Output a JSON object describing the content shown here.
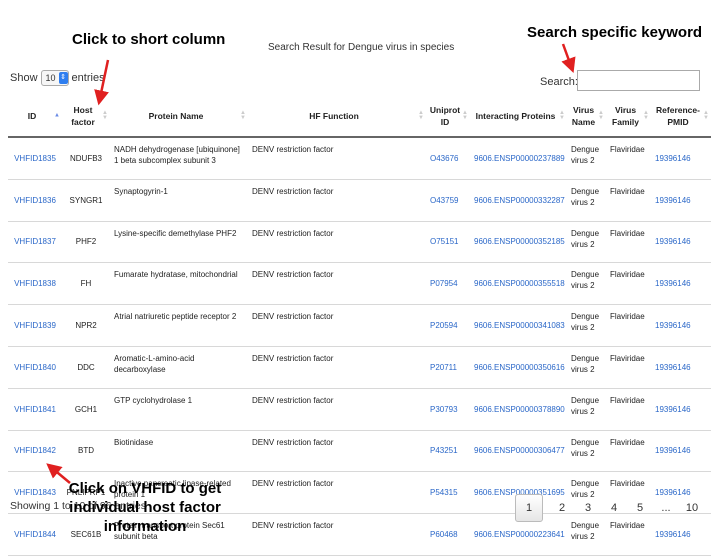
{
  "annotations": {
    "sort_hint": "Click to short column",
    "search_hint": "Search specific keyword",
    "vhfid_hint_line1": "Click on VHFID  to get",
    "vhfid_hint_line2": "individual host factor",
    "vhfid_hint_line3": "information"
  },
  "title": "Search Result for Dengue virus in species",
  "length_menu": {
    "prefix": "Show",
    "value": "10",
    "suffix": "entries"
  },
  "search": {
    "label": "Search:",
    "placeholder": ""
  },
  "columns": [
    "ID",
    "Host factor",
    "Protein Name",
    "HF Function",
    "Uniprot ID",
    "Interacting Proteins",
    "Virus Name",
    "Virus Family",
    "Reference-PMID"
  ],
  "rows": [
    {
      "id": "VHFID1835",
      "host": "NDUFB3",
      "protein": "NADH dehydrogenase [ubiquinone] 1 beta subcomplex subunit 3",
      "function": "DENV restriction factor",
      "uniprot": "O43676",
      "interacting": "9606.ENSP00000237889",
      "virus": "Dengue virus 2",
      "family": "Flaviridae",
      "pmid": "19396146"
    },
    {
      "id": "VHFID1836",
      "host": "SYNGR1",
      "protein": "Synaptogyrin-1",
      "function": "DENV restriction factor",
      "uniprot": "O43759",
      "interacting": "9606.ENSP00000332287",
      "virus": "Dengue virus 2",
      "family": "Flaviridae",
      "pmid": "19396146"
    },
    {
      "id": "VHFID1837",
      "host": "PHF2",
      "protein": "Lysine-specific demethylase PHF2",
      "function": "DENV restriction factor",
      "uniprot": "O75151",
      "interacting": "9606.ENSP00000352185",
      "virus": "Dengue virus 2",
      "family": "Flaviridae",
      "pmid": "19396146"
    },
    {
      "id": "VHFID1838",
      "host": "FH",
      "protein": "Fumarate hydratase, mitochondrial",
      "function": "DENV restriction factor",
      "uniprot": "P07954",
      "interacting": "9606.ENSP00000355518",
      "virus": "Dengue virus 2",
      "family": "Flaviridae",
      "pmid": "19396146"
    },
    {
      "id": "VHFID1839",
      "host": "NPR2",
      "protein": "Atrial natriuretic peptide receptor 2",
      "function": "DENV restriction factor",
      "uniprot": "P20594",
      "interacting": "9606.ENSP00000341083",
      "virus": "Dengue virus 2",
      "family": "Flaviridae",
      "pmid": "19396146"
    },
    {
      "id": "VHFID1840",
      "host": "DDC",
      "protein": "Aromatic-L-amino-acid decarboxylase",
      "function": "DENV restriction factor",
      "uniprot": "P20711",
      "interacting": "9606.ENSP00000350616",
      "virus": "Dengue virus 2",
      "family": "Flaviridae",
      "pmid": "19396146"
    },
    {
      "id": "VHFID1841",
      "host": "GCH1",
      "protein": "GTP cyclohydrolase 1",
      "function": "DENV restriction factor",
      "uniprot": "P30793",
      "interacting": "9606.ENSP00000378890",
      "virus": "Dengue virus 2",
      "family": "Flaviridae",
      "pmid": "19396146"
    },
    {
      "id": "VHFID1842",
      "host": "BTD",
      "protein": "Biotinidase",
      "function": "DENV restriction factor",
      "uniprot": "P43251",
      "interacting": "9606.ENSP00000306477",
      "virus": "Dengue virus 2",
      "family": "Flaviridae",
      "pmid": "19396146"
    },
    {
      "id": "VHFID1843",
      "host": "PNLIPRP1",
      "protein": "Inactive pancreatic lipase-related protein 1",
      "function": "DENV restriction factor",
      "uniprot": "P54315",
      "interacting": "9606.ENSP00000351695",
      "virus": "Dengue virus 2",
      "family": "Flaviridae",
      "pmid": "19396146"
    },
    {
      "id": "VHFID1844",
      "host": "SEC61B",
      "protein": "Protein transport protein Sec61 subunit beta",
      "function": "DENV restriction factor",
      "uniprot": "P60468",
      "interacting": "9606.ENSP00000223641",
      "virus": "Dengue virus 2",
      "family": "Flaviridae",
      "pmid": "19396146"
    }
  ],
  "info": "Showing 1 to 10 of 96 entries",
  "pagination": {
    "pages": [
      "1",
      "2",
      "3",
      "4",
      "5",
      "...",
      "10"
    ],
    "active": "1"
  },
  "colors": {
    "link": "#2a67c8",
    "arrow": "#e02020"
  }
}
